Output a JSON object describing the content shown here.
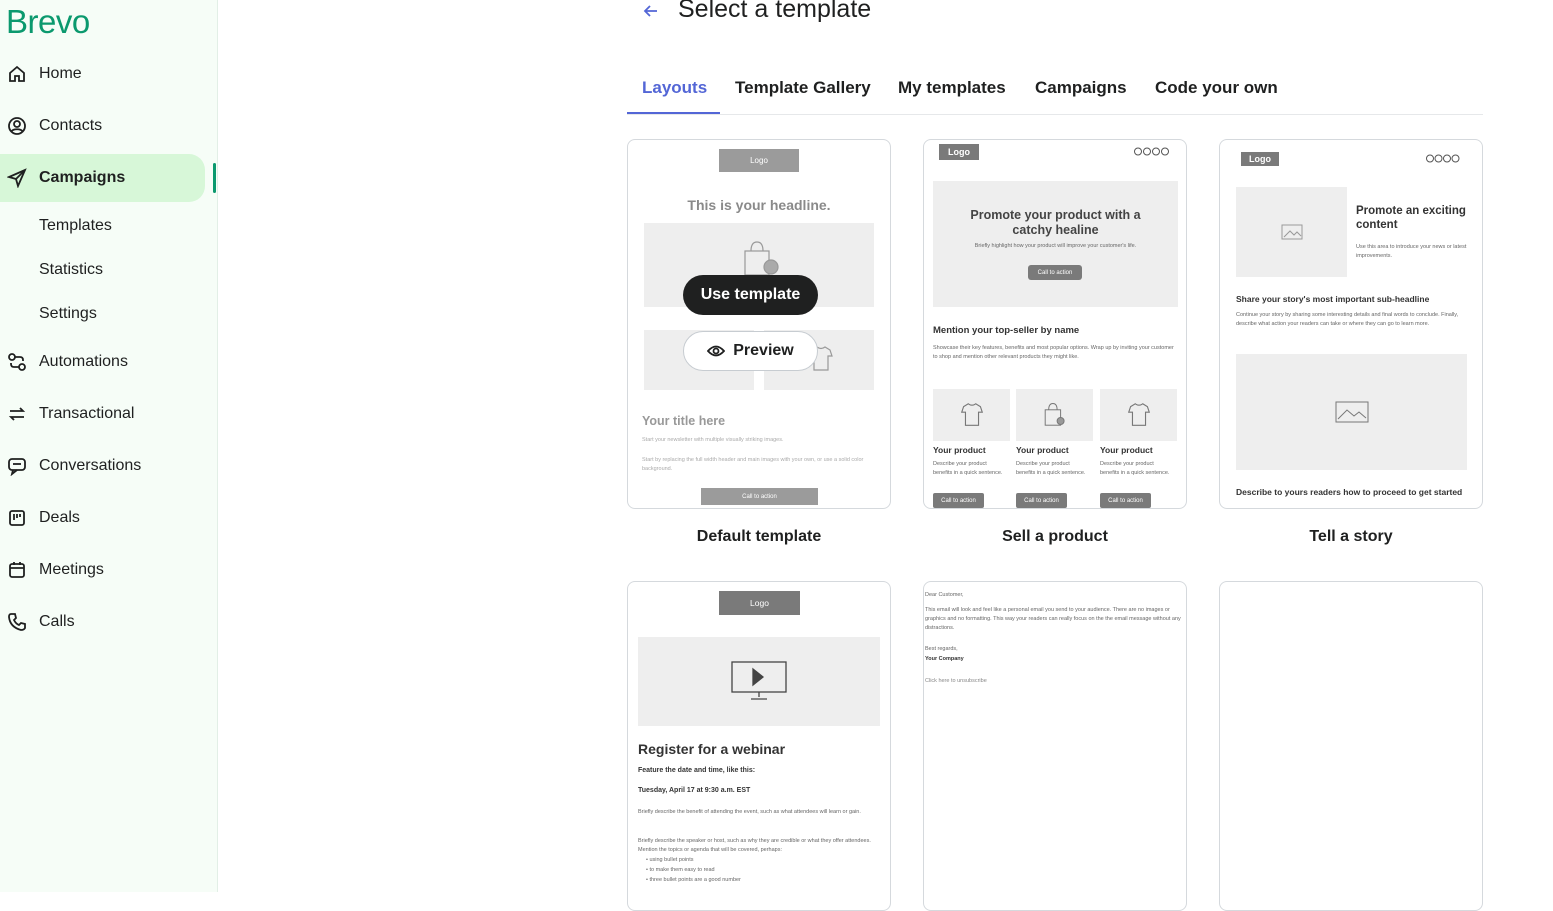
{
  "sidebar": {
    "logo": "Brevo",
    "items": [
      {
        "label": "Home",
        "icon": "home-icon"
      },
      {
        "label": "Contacts",
        "icon": "contacts-icon"
      },
      {
        "label": "Campaigns",
        "icon": "send-icon"
      },
      {
        "label": "Automations",
        "icon": "automations-icon"
      },
      {
        "label": "Transactional",
        "icon": "transactional-icon"
      },
      {
        "label": "Conversations",
        "icon": "conversations-icon"
      },
      {
        "label": "Deals",
        "icon": "deals-icon"
      },
      {
        "label": "Meetings",
        "icon": "calendar-icon"
      },
      {
        "label": "Calls",
        "icon": "phone-icon"
      }
    ],
    "sub_items": [
      "Templates",
      "Statistics",
      "Settings"
    ]
  },
  "header": {
    "title": "Select a template",
    "back_icon": "arrow-left-icon"
  },
  "tabs": [
    "Layouts",
    "Template Gallery",
    "My templates",
    "Campaigns",
    "Code your own"
  ],
  "active_tab": "Layouts",
  "accent_color": "#5366d6",
  "brand_color": "#0b996e",
  "cards": {
    "default": {
      "label": "Default template",
      "logo": "Logo",
      "headline": "This is your headline.",
      "title": "Your title here",
      "p1": "Start your newsletter with multiple visually striking images.",
      "p2": "Start by replacing the full width header and main images with your own, or use a solid color background.",
      "cta": "Call to action",
      "use_button": "Use template",
      "preview_button": "Preview"
    },
    "sell": {
      "label": "Sell a product",
      "logo": "Logo",
      "hero_title": "Promote your product with a catchy healine",
      "hero_text": "Briefly highlight how your product will improve your customer's life.",
      "cta": "Call to action",
      "section_title": "Mention your top-seller by name",
      "section_text": "Showcase their key features, benefits and most popular options. Wrap up by inviting your customer to shop and mention other relevant products they might like.",
      "products": [
        {
          "name": "Your product",
          "desc": "Describe your product benefits in a quick sentence.",
          "cta": "Call to action"
        },
        {
          "name": "Your product",
          "desc": "Describe your product benefits in a quick sentence.",
          "cta": "Call to action"
        },
        {
          "name": "Your product",
          "desc": "Describe your product benefits in a quick sentence.",
          "cta": "Call to action"
        }
      ]
    },
    "story": {
      "label": "Tell a story",
      "logo": "Logo",
      "promo_title": "Promote an exciting content",
      "promo_text": "Use this area to introduce your news or latest improvements.",
      "sub_headline": "Share your story's most important sub-headline",
      "sub_text": "Continue your story by sharing some interesting details and final words to conclude. Finally, describe what action your readers can take or where they can go to learn more.",
      "bottom": "Describe to yours readers how to proceed to get started"
    },
    "webinar": {
      "logo": "Logo",
      "title": "Register for a webinar",
      "feature": "Feature the date and time, like this:",
      "date": "Tuesday, April 17 at 9:30 a.m. EST",
      "p1": "Briefly describe the benefit of attending the event, such as what attendees will learn or gain.",
      "p2": "Briefly describe the speaker or host, such as why they are credible or what they offer attendees. Mention the topics or agenda that will be covered, perhaps:",
      "bullets": [
        "using bullet points",
        "to make them easy to read",
        "three bullet points are a good number"
      ]
    },
    "plain": {
      "greeting": "Dear Customer,",
      "body": "This email will look and feel like a personal email you send to your audience. There are no images or graphics and no formatting. This way your readers can really focus on the the email message without any distractions.",
      "regards": "Best regards,",
      "company": "Your Company",
      "unsubscribe": "Click here to unsubscribe"
    }
  }
}
